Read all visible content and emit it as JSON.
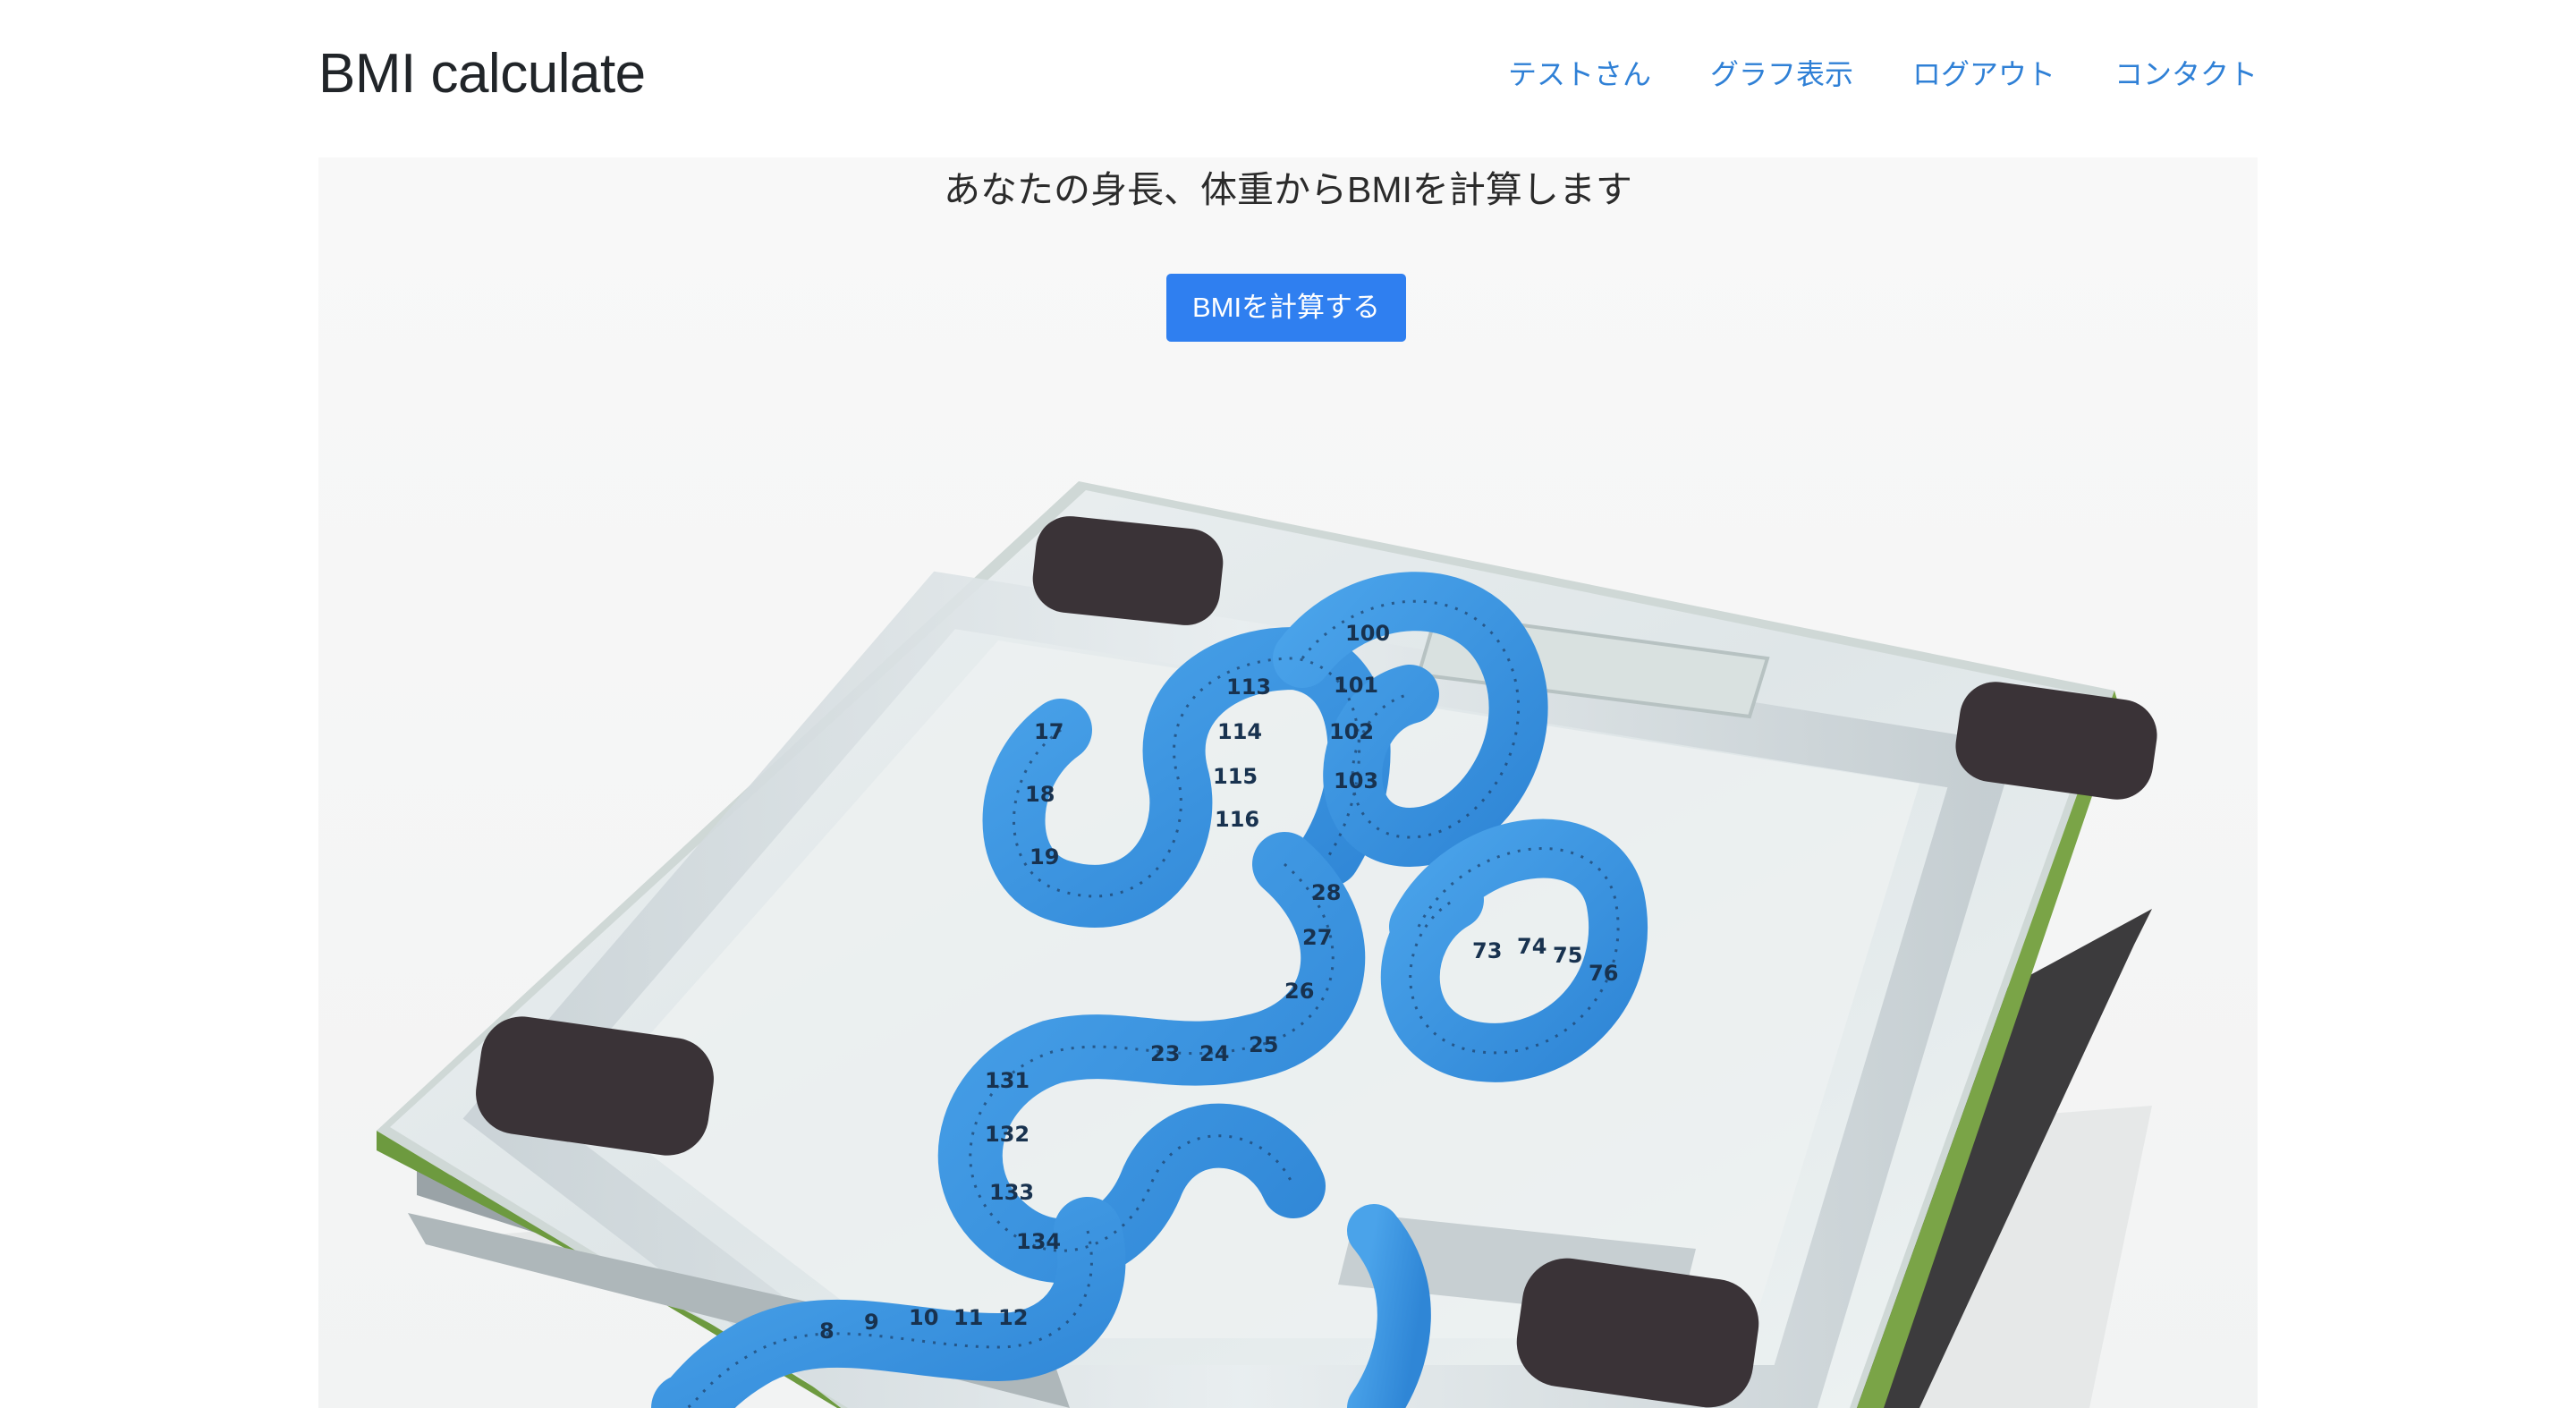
{
  "navbar": {
    "brand": "BMI calculate",
    "links": [
      {
        "label": "テストさん"
      },
      {
        "label": "グラフ表示"
      },
      {
        "label": "ログアウト"
      },
      {
        "label": "コンタクト"
      }
    ],
    "link_color": "#2f80d6"
  },
  "hero": {
    "headline": "あなたの身長、体重からBMIを計算します",
    "button_label": "BMIを計算する",
    "button_color": "#2f7ff0",
    "image": "bathroom-scale-with-measuring-tape-photo"
  },
  "tape_labels": {
    "a": [
      "113",
      "114",
      "115",
      "116"
    ],
    "b": [
      "100",
      "101",
      "102",
      "103"
    ],
    "c": [
      "17",
      "18",
      "19"
    ],
    "d": [
      "23",
      "24",
      "25",
      "26",
      "27",
      "28"
    ],
    "e": [
      "131",
      "132",
      "133",
      "134"
    ],
    "f": [
      "8",
      "9",
      "10",
      "11",
      "12"
    ],
    "g": [
      "73",
      "74",
      "75",
      "76"
    ]
  }
}
